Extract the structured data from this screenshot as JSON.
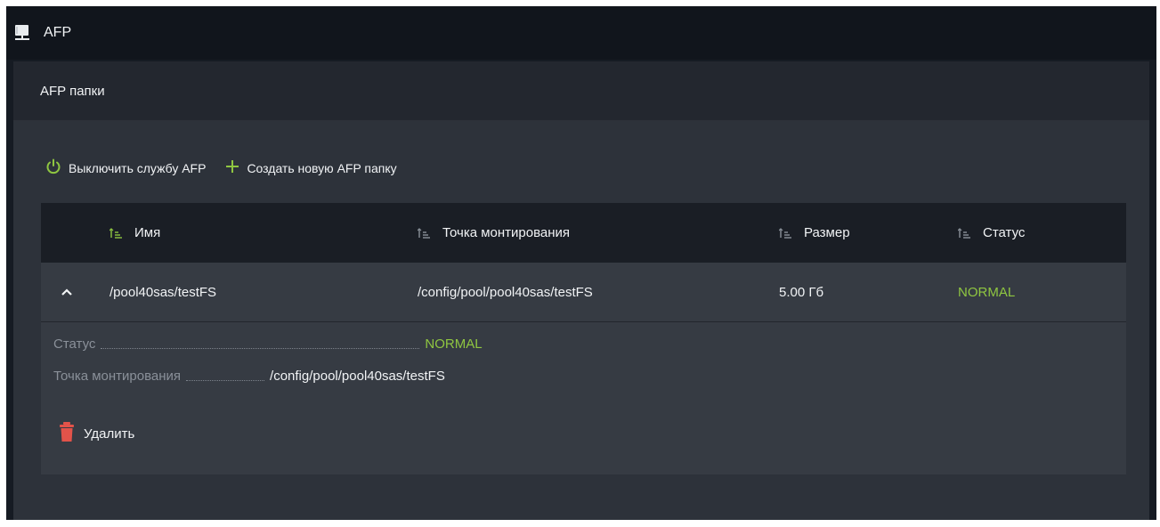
{
  "header": {
    "title": "AFP",
    "icon": "network-folder-icon"
  },
  "panel": {
    "title": "AFP папки"
  },
  "toolbar": {
    "disable_label": "Выключить службу AFP",
    "create_label": "Создать новую AFP папку",
    "accent": "#8fc641"
  },
  "table": {
    "columns": [
      "Имя",
      "Точка монтирования",
      "Размер",
      "Статус"
    ],
    "rows": [
      {
        "name": "/pool40sas/testFS",
        "mount": "/config/pool/pool40sas/testFS",
        "size": "5.00 Гб",
        "status": "NORMAL"
      }
    ]
  },
  "details": {
    "status_key": "Статус",
    "status_value": "NORMAL",
    "mount_key": "Точка монтирования",
    "mount_value": "/config/pool/pool40sas/testFS",
    "delete_label": "Удалить",
    "delete_color": "#e2534a"
  }
}
